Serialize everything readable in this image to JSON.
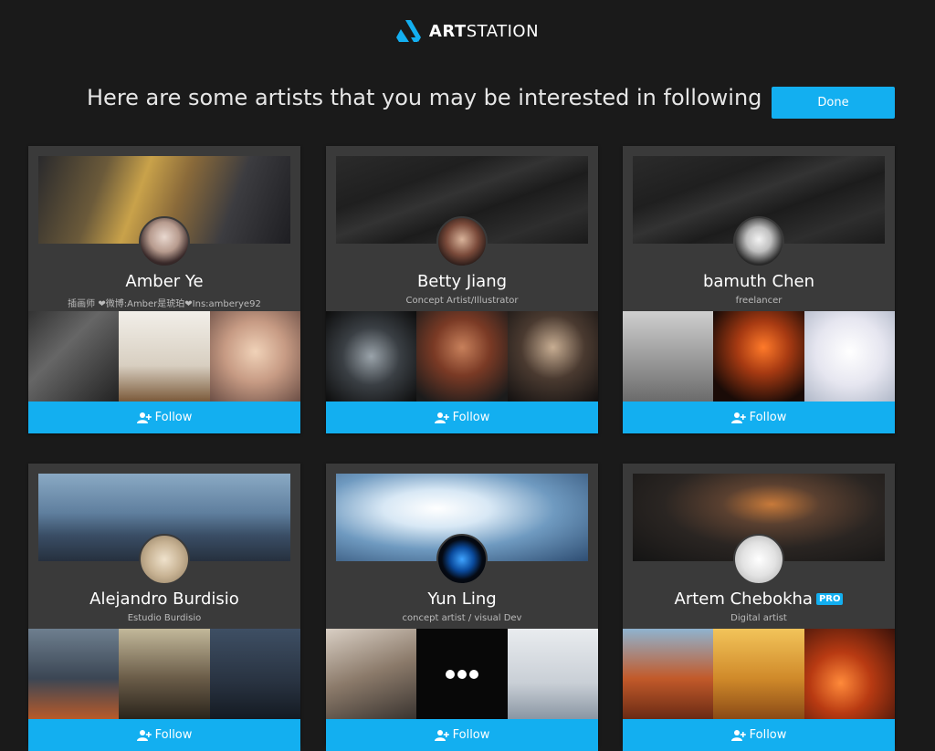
{
  "logo": {
    "strong": "ART",
    "light": "STATION",
    "icon": "artstation-logo-icon"
  },
  "headline": "Here are some artists that you may be interested in following",
  "done_label": "Done",
  "follow_label": "Follow",
  "colors": {
    "accent": "#13aff0",
    "background": "#1a1a1a",
    "card": "#3a3a3a"
  },
  "artists": [
    {
      "name": "Amber Ye",
      "subtitle": "插画师 ❤微博:Amber是琥珀❤Ins:amberye92",
      "pro": false
    },
    {
      "name": "Betty Jiang",
      "subtitle": "Concept Artist/Illustrator",
      "pro": false
    },
    {
      "name": "bamuth Chen",
      "subtitle": "freelancer",
      "pro": false
    },
    {
      "name": "Alejandro Burdisio",
      "subtitle": "Estudio Burdisio",
      "pro": false
    },
    {
      "name": "Yun Ling",
      "subtitle": "concept artist / visual Dev",
      "pro": false
    },
    {
      "name": "Artem Chebokha",
      "subtitle": "Digital artist",
      "pro": true,
      "pro_label": "PRO"
    }
  ]
}
